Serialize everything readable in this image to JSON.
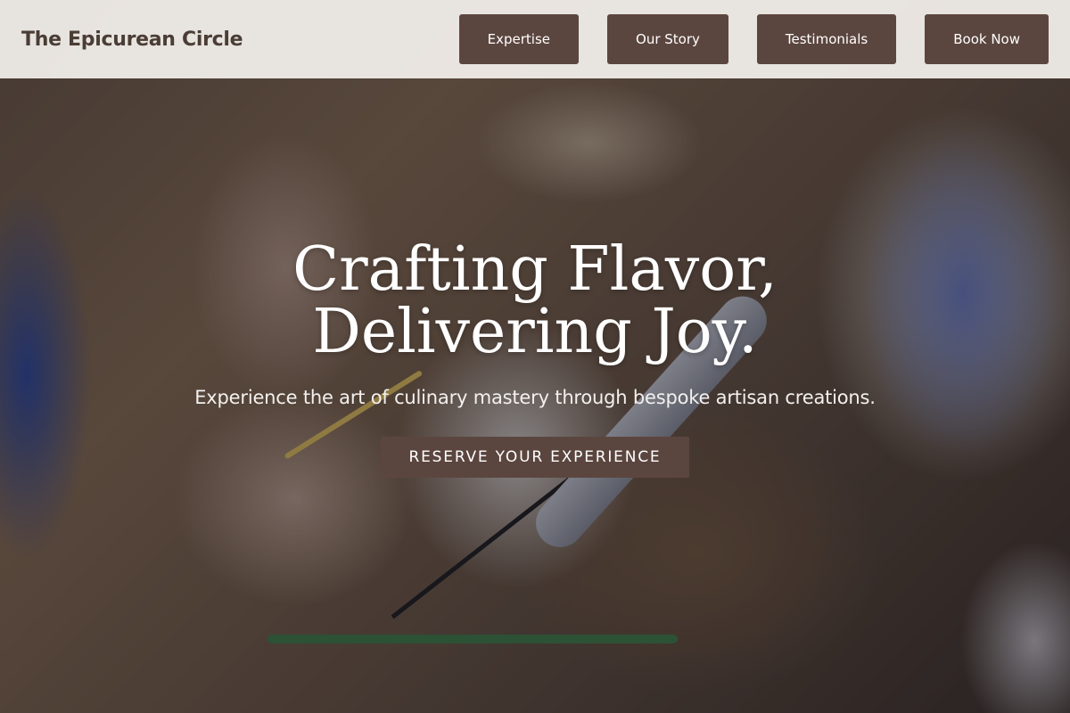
{
  "header": {
    "brand": "The Epicurean Circle",
    "nav": [
      {
        "label": "Expertise"
      },
      {
        "label": "Our Story"
      },
      {
        "label": "Testimonials"
      },
      {
        "label": "Book Now"
      }
    ]
  },
  "hero": {
    "title_line_1": "Crafting Flavor,",
    "title_line_2": "Delivering Joy.",
    "subtitle": "Experience the art of culinary mastery through bespoke artisan creations.",
    "cta_label": "RESERVE YOUR EXPERIENCE"
  },
  "colors": {
    "accent": "#5b463f",
    "header_bg": "#f5f2ee",
    "brand_text": "#4a3d36"
  }
}
